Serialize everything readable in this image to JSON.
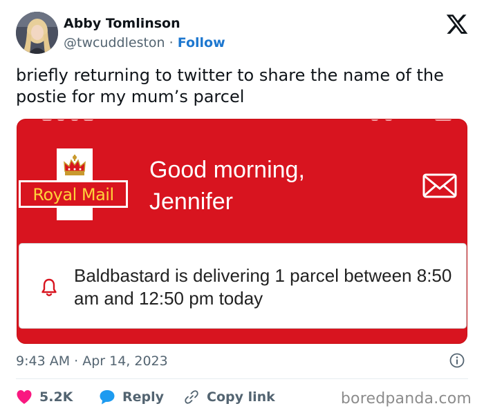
{
  "author": {
    "name": "Abby Tomlinson",
    "handle": "@twcuddleston",
    "separator": "·",
    "follow_label": "Follow",
    "avatar_icon": "profile-photo"
  },
  "platform_icon": "x-logo",
  "tweet": {
    "text": "briefly returning to twitter to share the name of the postie for my mum’s parcel"
  },
  "media": {
    "logo_text": "Royal Mail",
    "greeting": "Good morning,",
    "greeting_name": "Jennifer",
    "mail_icon": "envelope-icon",
    "notification": {
      "icon": "bell-icon",
      "text": "Baldbastard is delivering 1 parcel between 8:50 am and 12:50 pm today"
    },
    "colors": {
      "brand_red": "#d8141f",
      "logo_yellow": "#ffd23a"
    }
  },
  "meta": {
    "timestamp": "9:43 AM · Apr 14, 2023",
    "info_icon": "info-icon"
  },
  "actions": {
    "likes_count": "5.2K",
    "reply_label": "Reply",
    "copy_label": "Copy link"
  },
  "watermark": "boredpanda.com",
  "colors": {
    "like_red": "#f91880",
    "reply_blue": "#1d9bf0",
    "follow_blue": "#1d77cf"
  }
}
